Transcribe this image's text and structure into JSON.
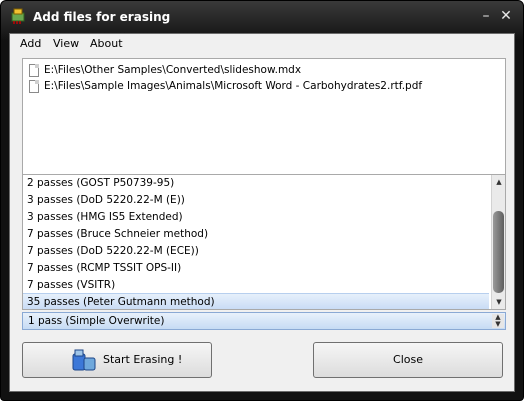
{
  "window": {
    "title": "Add files for erasing",
    "minimize_icon": "minimize-icon",
    "close_icon": "close-icon"
  },
  "menu": [
    "Add",
    "View",
    "About"
  ],
  "files": [
    "E:\\Files\\Other Samples\\Converted\\slideshow.mdx",
    "E:\\Files\\Sample Images\\Animals\\Microsoft Word - Carbohydrates2.rtf.pdf"
  ],
  "passes": [
    "2 passes (GOST P50739-95)",
    "3 passes (DoD 5220.22-M (E))",
    "3 passes (HMG IS5 Extended)",
    "7 passes (Bruce Schneier method)",
    "7 passes (DoD 5220.22-M (ECE))",
    "7 passes (RCMP TSSIT OPS-II)",
    "7 passes (VSITR)",
    "35 passes (Peter Gutmann method)"
  ],
  "selected_pass_index": 7,
  "method_combo": {
    "value": "1 pass (Simple Overwrite)"
  },
  "buttons": {
    "start_label": "Start Erasing !",
    "close_label": "Close"
  },
  "colors": {
    "titlebar": "#1a1a1a",
    "selection": "#c9dcf5"
  }
}
